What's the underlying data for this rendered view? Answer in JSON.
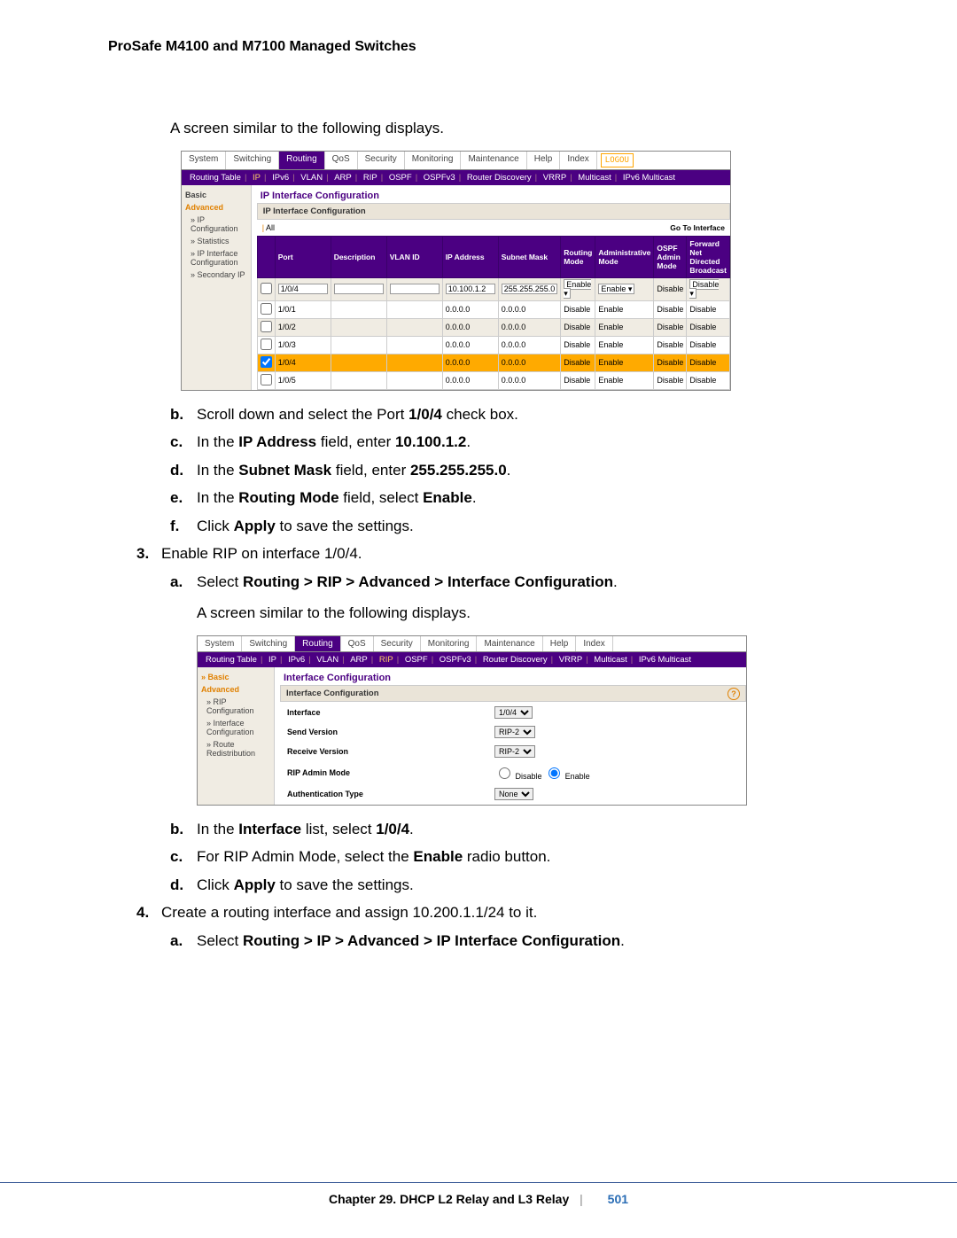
{
  "header": "ProSafe M4100 and M7100 Managed Switches",
  "intro1": "A screen similar to the following displays.",
  "screenshot1": {
    "tabs": [
      "System",
      "Switching",
      "Routing",
      "QoS",
      "Security",
      "Monitoring",
      "Maintenance",
      "Help",
      "Index"
    ],
    "activeTab": "Routing",
    "logout": "LOGOU",
    "subtabs": [
      "Routing Table",
      "IP",
      "IPv6",
      "VLAN",
      "ARP",
      "RIP",
      "OSPF",
      "OSPFv3",
      "Router Discovery",
      "VRRP",
      "Multicast",
      "IPv6 Multicast"
    ],
    "activeSub": "IP",
    "sidebar": {
      "basic": "Basic",
      "advanced": "Advanced",
      "items": [
        "IP Configuration",
        "Statistics",
        "IP Interface Configuration",
        "Secondary IP"
      ],
      "selectedIdx": 2
    },
    "title": "IP Interface Configuration",
    "panelHeader": "IP Interface Configuration",
    "all": "All",
    "goto": "Go To Interface",
    "columns": [
      "",
      "Port",
      "Description",
      "VLAN ID",
      "IP Address",
      "Subnet Mask",
      "Routing Mode",
      "Administrative Mode",
      "OSPF Admin Mode",
      "Forward Net Directed Broadcast"
    ],
    "editRow": {
      "port": "1/0/4",
      "ip": "10.100.1.2",
      "mask": "255.255.255.0",
      "rmode": "Enable",
      "amode": "Enable",
      "ospf": "Disable",
      "fwd": "Disable"
    },
    "rows": [
      {
        "port": "1/0/1",
        "ip": "0.0.0.0",
        "mask": "0.0.0.0",
        "rmode": "Disable",
        "amode": "Enable",
        "ospf": "Disable",
        "fwd": "Disable",
        "alt": false,
        "hl": false,
        "chk": false
      },
      {
        "port": "1/0/2",
        "ip": "0.0.0.0",
        "mask": "0.0.0.0",
        "rmode": "Disable",
        "amode": "Enable",
        "ospf": "Disable",
        "fwd": "Disable",
        "alt": true,
        "hl": false,
        "chk": false
      },
      {
        "port": "1/0/3",
        "ip": "0.0.0.0",
        "mask": "0.0.0.0",
        "rmode": "Disable",
        "amode": "Enable",
        "ospf": "Disable",
        "fwd": "Disable",
        "alt": false,
        "hl": false,
        "chk": false
      },
      {
        "port": "1/0/4",
        "ip": "0.0.0.0",
        "mask": "0.0.0.0",
        "rmode": "Disable",
        "amode": "Enable",
        "ospf": "Disable",
        "fwd": "Disable",
        "alt": false,
        "hl": true,
        "chk": true
      },
      {
        "port": "1/0/5",
        "ip": "0.0.0.0",
        "mask": "0.0.0.0",
        "rmode": "Disable",
        "amode": "Enable",
        "ospf": "Disable",
        "fwd": "Disable",
        "alt": false,
        "hl": false,
        "chk": false
      }
    ]
  },
  "steps1": {
    "b": {
      "pre": "Scroll down and select the Port ",
      "bold": "1/0/4",
      "post": " check box."
    },
    "c": {
      "pre": "In the ",
      "bold": "IP Address",
      "mid": " field, enter ",
      "val": "10.100.1.2",
      "post": "."
    },
    "d": {
      "pre": "In the ",
      "bold": "Subnet Mask",
      "mid": " field, enter ",
      "val": "255.255.255.0",
      "post": "."
    },
    "e": {
      "pre": "In the ",
      "bold": "Routing Mode",
      "mid": " field, select ",
      "val": "Enable",
      "post": "."
    },
    "f": {
      "pre": "Click ",
      "bold": "Apply",
      "post": " to save the settings."
    }
  },
  "step3": {
    "num": "3.",
    "text": "Enable RIP on interface 1/0/4."
  },
  "step3a": {
    "lbl": "a.",
    "pre": "Select ",
    "path": "Routing > RIP > Advanced > Interface Configuration",
    "post": "."
  },
  "intro2": "A screen similar to the following displays.",
  "screenshot2": {
    "tabs": [
      "System",
      "Switching",
      "Routing",
      "QoS",
      "Security",
      "Monitoring",
      "Maintenance",
      "Help",
      "Index"
    ],
    "subtabs": [
      "Routing Table",
      "IP",
      "IPv6",
      "VLAN",
      "ARP",
      "RIP",
      "OSPF",
      "OSPFv3",
      "Router Discovery",
      "VRRP",
      "Multicast",
      "IPv6 Multicast"
    ],
    "activeSub": "RIP",
    "sidebar": {
      "basic": "Basic",
      "advanced": "Advanced",
      "items": [
        "RIP Configuration",
        "Interface Configuration",
        "Route Redistribution"
      ],
      "selectedIdx": 1
    },
    "title": "Interface Configuration",
    "panelHeader": "Interface Configuration",
    "fields": {
      "interface": {
        "label": "Interface",
        "value": "1/0/4"
      },
      "sendv": {
        "label": "Send Version",
        "value": "RIP-2"
      },
      "recvv": {
        "label": "Receive Version",
        "value": "RIP-2"
      },
      "admin": {
        "label": "RIP Admin Mode",
        "disable": "Disable",
        "enable": "Enable"
      },
      "auth": {
        "label": "Authentication Type",
        "value": "None"
      }
    }
  },
  "steps2": {
    "b": {
      "pre": "In the ",
      "bold": "Interface",
      "mid": " list, select ",
      "val": "1/0/4",
      "post": "."
    },
    "c": {
      "pre": "For RIP Admin Mode, select the ",
      "bold": "Enable",
      "post": " radio button."
    },
    "d": {
      "pre": "Click ",
      "bold": "Apply",
      "post": " to save the settings."
    }
  },
  "step4": {
    "num": "4.",
    "text": "Create a routing interface and assign 10.200.1.1/24 to it."
  },
  "step4a": {
    "lbl": "a.",
    "pre": "Select ",
    "path": "Routing > IP > Advanced > IP Interface Configuration",
    "post": "."
  },
  "footer": {
    "chapter": "Chapter 29.  DHCP L2 Relay and L3 Relay",
    "page": "501"
  }
}
